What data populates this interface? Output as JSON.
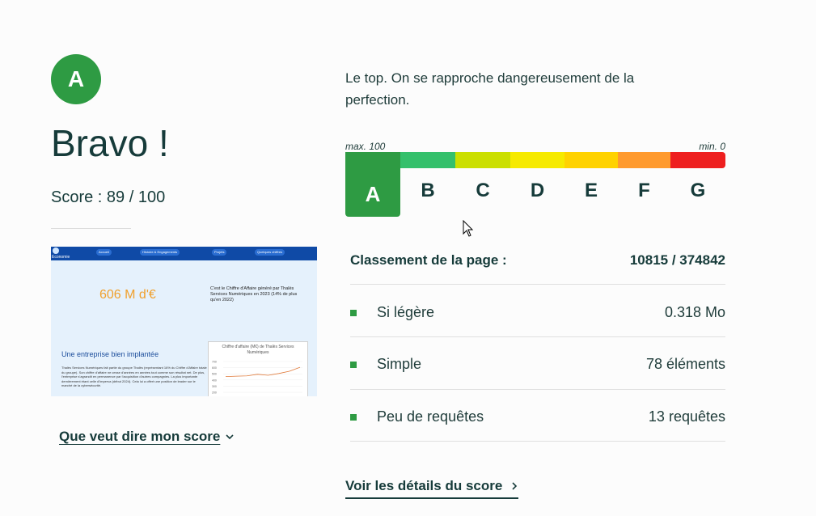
{
  "result": {
    "grade": "A",
    "headline": "Bravo !",
    "score_text": "Score : 89 / 100",
    "score_link": "Que veut dire mon score"
  },
  "thumbnail": {
    "logo_text": "Economie",
    "nav": [
      "Accueil",
      "Histoire & Engagements",
      "Projets",
      "Quelques chiffres"
    ],
    "amount": "606 M d'€",
    "description": "C'est le Chiffre d'Affaire généré par Thalès Services Numériques en 2023 (14% de plus qu'en 2022)",
    "section_title": "Une entreprise bien implantée",
    "paragraph": "Thalès Services Numériques fait partie du groupe Thalès (représentant 16% du Chiffre d'Affaire totale du groupe). Son chiffre d'affaire ne cesse d'années en années tout comme son résultat net. De plus, l'entreprise s'agrandit en permanence par l'acquisition d'autres compagnies. La plus importante dernièrement étant celle d'Imperva (début 2024). Cela lui a offert une position de leader sur le marché de la cybersécurité.",
    "chart_title": "Chiffre d'affaire (M€) de Thalès Services Numériques",
    "chart_yticks": [
      "700",
      "600",
      "500",
      "400",
      "300",
      "200"
    ],
    "chart_values": [
      455,
      462,
      466,
      492,
      476,
      505,
      542,
      606
    ]
  },
  "grade_panel": {
    "quote": "Le top. On se rapproche dangereusement de la perfection.",
    "max_label": "max. 100",
    "min_label": "min. 0",
    "grades": [
      {
        "letter": "A",
        "color": "#2e9b43"
      },
      {
        "letter": "B",
        "color": "#34c06b"
      },
      {
        "letter": "C",
        "color": "#cbdf00"
      },
      {
        "letter": "D",
        "color": "#f6ea00"
      },
      {
        "letter": "E",
        "color": "#ffd200"
      },
      {
        "letter": "F",
        "color": "#ff9a2e"
      },
      {
        "letter": "G",
        "color": "#ee1f1f"
      }
    ],
    "active_grade": "A"
  },
  "ranking": {
    "label": "Classement de la page :",
    "value": "10815 / 374842"
  },
  "metrics": [
    {
      "label": "Si légère",
      "value": "0.318 Mo"
    },
    {
      "label": "Simple",
      "value": "78 éléments"
    },
    {
      "label": "Peu de requêtes",
      "value": "13 requêtes"
    }
  ],
  "details_link": "Voir les détails du score",
  "colors": {
    "accent": "#2e9b43",
    "text": "#163b3a"
  }
}
